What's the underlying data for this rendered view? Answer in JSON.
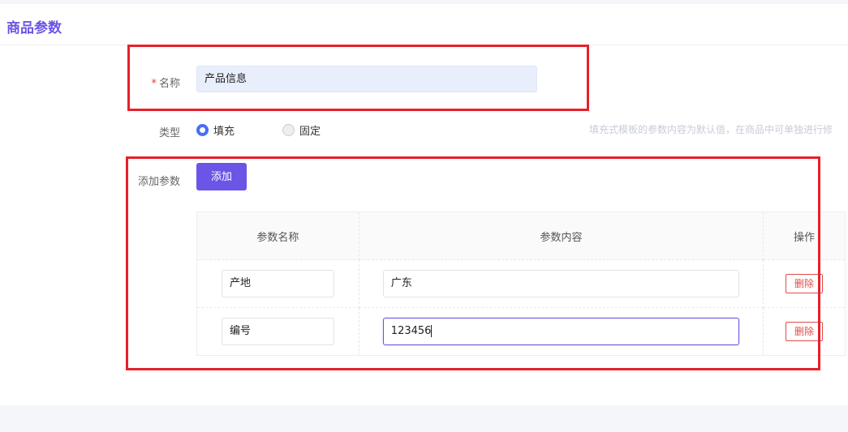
{
  "header": {
    "title": "商品参数"
  },
  "form": {
    "name": {
      "required_mark": "*",
      "label": "名称",
      "value": "产品信息"
    },
    "type": {
      "label": "类型",
      "options": [
        {
          "label": "填充",
          "selected": true
        },
        {
          "label": "固定",
          "selected": false
        }
      ],
      "hint": "填充式模板的参数内容为默认值，在商品中可单独进行修"
    },
    "params": {
      "label": "添加参数",
      "add_label": "添加",
      "columns": [
        "参数名称",
        "参数内容",
        "操作"
      ],
      "rows": [
        {
          "name": "产地",
          "content": "广东",
          "action": "删除"
        },
        {
          "name": "编号",
          "content": "123456",
          "action": "删除"
        }
      ]
    }
  },
  "colors": {
    "accent": "#6a55e6",
    "radio": "#4a6cf7",
    "danger": "#e34a4a",
    "highlight_box": "#e8202a"
  }
}
